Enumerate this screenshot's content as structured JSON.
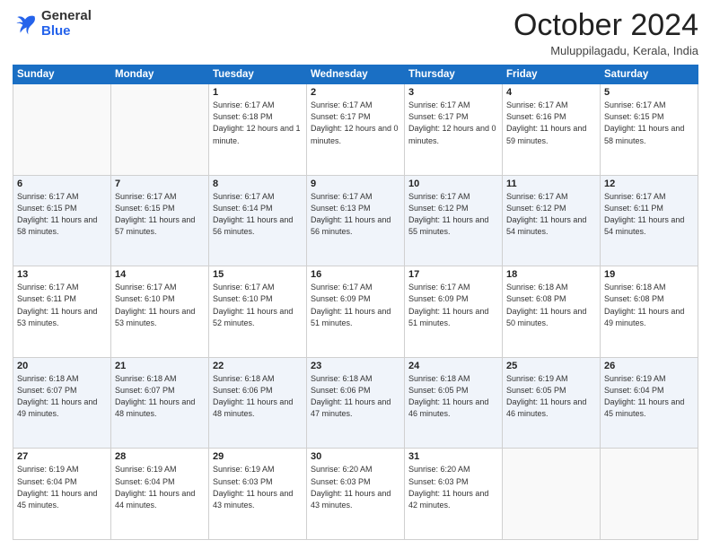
{
  "logo": {
    "general": "General",
    "blue": "Blue"
  },
  "header": {
    "month": "October 2024",
    "location": "Muluppilagadu, Kerala, India"
  },
  "columns": [
    "Sunday",
    "Monday",
    "Tuesday",
    "Wednesday",
    "Thursday",
    "Friday",
    "Saturday"
  ],
  "weeks": [
    [
      {
        "day": "",
        "sunrise": "",
        "sunset": "",
        "daylight": ""
      },
      {
        "day": "",
        "sunrise": "",
        "sunset": "",
        "daylight": ""
      },
      {
        "day": "1",
        "sunrise": "Sunrise: 6:17 AM",
        "sunset": "Sunset: 6:18 PM",
        "daylight": "Daylight: 12 hours and 1 minute."
      },
      {
        "day": "2",
        "sunrise": "Sunrise: 6:17 AM",
        "sunset": "Sunset: 6:17 PM",
        "daylight": "Daylight: 12 hours and 0 minutes."
      },
      {
        "day": "3",
        "sunrise": "Sunrise: 6:17 AM",
        "sunset": "Sunset: 6:17 PM",
        "daylight": "Daylight: 12 hours and 0 minutes."
      },
      {
        "day": "4",
        "sunrise": "Sunrise: 6:17 AM",
        "sunset": "Sunset: 6:16 PM",
        "daylight": "Daylight: 11 hours and 59 minutes."
      },
      {
        "day": "5",
        "sunrise": "Sunrise: 6:17 AM",
        "sunset": "Sunset: 6:15 PM",
        "daylight": "Daylight: 11 hours and 58 minutes."
      }
    ],
    [
      {
        "day": "6",
        "sunrise": "Sunrise: 6:17 AM",
        "sunset": "Sunset: 6:15 PM",
        "daylight": "Daylight: 11 hours and 58 minutes."
      },
      {
        "day": "7",
        "sunrise": "Sunrise: 6:17 AM",
        "sunset": "Sunset: 6:15 PM",
        "daylight": "Daylight: 11 hours and 57 minutes."
      },
      {
        "day": "8",
        "sunrise": "Sunrise: 6:17 AM",
        "sunset": "Sunset: 6:14 PM",
        "daylight": "Daylight: 11 hours and 56 minutes."
      },
      {
        "day": "9",
        "sunrise": "Sunrise: 6:17 AM",
        "sunset": "Sunset: 6:13 PM",
        "daylight": "Daylight: 11 hours and 56 minutes."
      },
      {
        "day": "10",
        "sunrise": "Sunrise: 6:17 AM",
        "sunset": "Sunset: 6:12 PM",
        "daylight": "Daylight: 11 hours and 55 minutes."
      },
      {
        "day": "11",
        "sunrise": "Sunrise: 6:17 AM",
        "sunset": "Sunset: 6:12 PM",
        "daylight": "Daylight: 11 hours and 54 minutes."
      },
      {
        "day": "12",
        "sunrise": "Sunrise: 6:17 AM",
        "sunset": "Sunset: 6:11 PM",
        "daylight": "Daylight: 11 hours and 54 minutes."
      }
    ],
    [
      {
        "day": "13",
        "sunrise": "Sunrise: 6:17 AM",
        "sunset": "Sunset: 6:11 PM",
        "daylight": "Daylight: 11 hours and 53 minutes."
      },
      {
        "day": "14",
        "sunrise": "Sunrise: 6:17 AM",
        "sunset": "Sunset: 6:10 PM",
        "daylight": "Daylight: 11 hours and 53 minutes."
      },
      {
        "day": "15",
        "sunrise": "Sunrise: 6:17 AM",
        "sunset": "Sunset: 6:10 PM",
        "daylight": "Daylight: 11 hours and 52 minutes."
      },
      {
        "day": "16",
        "sunrise": "Sunrise: 6:17 AM",
        "sunset": "Sunset: 6:09 PM",
        "daylight": "Daylight: 11 hours and 51 minutes."
      },
      {
        "day": "17",
        "sunrise": "Sunrise: 6:17 AM",
        "sunset": "Sunset: 6:09 PM",
        "daylight": "Daylight: 11 hours and 51 minutes."
      },
      {
        "day": "18",
        "sunrise": "Sunrise: 6:18 AM",
        "sunset": "Sunset: 6:08 PM",
        "daylight": "Daylight: 11 hours and 50 minutes."
      },
      {
        "day": "19",
        "sunrise": "Sunrise: 6:18 AM",
        "sunset": "Sunset: 6:08 PM",
        "daylight": "Daylight: 11 hours and 49 minutes."
      }
    ],
    [
      {
        "day": "20",
        "sunrise": "Sunrise: 6:18 AM",
        "sunset": "Sunset: 6:07 PM",
        "daylight": "Daylight: 11 hours and 49 minutes."
      },
      {
        "day": "21",
        "sunrise": "Sunrise: 6:18 AM",
        "sunset": "Sunset: 6:07 PM",
        "daylight": "Daylight: 11 hours and 48 minutes."
      },
      {
        "day": "22",
        "sunrise": "Sunrise: 6:18 AM",
        "sunset": "Sunset: 6:06 PM",
        "daylight": "Daylight: 11 hours and 48 minutes."
      },
      {
        "day": "23",
        "sunrise": "Sunrise: 6:18 AM",
        "sunset": "Sunset: 6:06 PM",
        "daylight": "Daylight: 11 hours and 47 minutes."
      },
      {
        "day": "24",
        "sunrise": "Sunrise: 6:18 AM",
        "sunset": "Sunset: 6:05 PM",
        "daylight": "Daylight: 11 hours and 46 minutes."
      },
      {
        "day": "25",
        "sunrise": "Sunrise: 6:19 AM",
        "sunset": "Sunset: 6:05 PM",
        "daylight": "Daylight: 11 hours and 46 minutes."
      },
      {
        "day": "26",
        "sunrise": "Sunrise: 6:19 AM",
        "sunset": "Sunset: 6:04 PM",
        "daylight": "Daylight: 11 hours and 45 minutes."
      }
    ],
    [
      {
        "day": "27",
        "sunrise": "Sunrise: 6:19 AM",
        "sunset": "Sunset: 6:04 PM",
        "daylight": "Daylight: 11 hours and 45 minutes."
      },
      {
        "day": "28",
        "sunrise": "Sunrise: 6:19 AM",
        "sunset": "Sunset: 6:04 PM",
        "daylight": "Daylight: 11 hours and 44 minutes."
      },
      {
        "day": "29",
        "sunrise": "Sunrise: 6:19 AM",
        "sunset": "Sunset: 6:03 PM",
        "daylight": "Daylight: 11 hours and 43 minutes."
      },
      {
        "day": "30",
        "sunrise": "Sunrise: 6:20 AM",
        "sunset": "Sunset: 6:03 PM",
        "daylight": "Daylight: 11 hours and 43 minutes."
      },
      {
        "day": "31",
        "sunrise": "Sunrise: 6:20 AM",
        "sunset": "Sunset: 6:03 PM",
        "daylight": "Daylight: 11 hours and 42 minutes."
      },
      {
        "day": "",
        "sunrise": "",
        "sunset": "",
        "daylight": ""
      },
      {
        "day": "",
        "sunrise": "",
        "sunset": "",
        "daylight": ""
      }
    ]
  ]
}
